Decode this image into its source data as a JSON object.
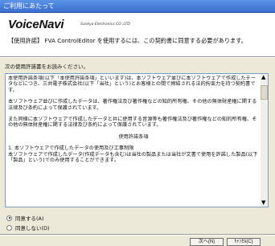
{
  "window": {
    "title": "ご利用にあたって"
  },
  "header": {
    "logo": "VoiceNavi",
    "company": "Sankyo Electronics CO.,LTD",
    "description": "【使用許諾】 FVA ControlEditor を使用するには、この契約書に同意する必要があります。"
  },
  "prompt": "次の使用許諾書をお読みください。",
  "license": {
    "p1": "本使用許諾条項(以下「本使用許諾条項」といいます)は、本ソフトウェア並びに本ソフトウェアで作成したデータなどにつき、三共電子株式会社(以下「当社」という)とお客様との間で締結される法的拘束力を持つ契約書です。",
    "p2": "本ソフトウェア並びに作成したデータは、著作権法及び著作権などの知的所有権、その他の無体財産権に関する法律及び条約によって保護されています。",
    "p3": "また同様に本ソフトウェアで作成したデータと共に使用する音源等も著作権法及び著作権などの知的所有権、その他の無体財産権に関する法律及び条約によって保護されています。",
    "heading": "使用許諾条項",
    "p4": "1. 本ソフトウェアで作成したデータの使用及び工事制限\n本ソフトウェアで作成したデータ(作成データも含む)は当社の製品または当社が文書で使用を許諾した製品(以下「製品」という)でのみ使用することができます。"
  },
  "options": {
    "agree": "同意する(A)",
    "disagree": "同意しない(D)"
  },
  "buttons": {
    "next": "次へ(N)",
    "cancel": "ｷｬﾝｾﾙ(C)"
  }
}
